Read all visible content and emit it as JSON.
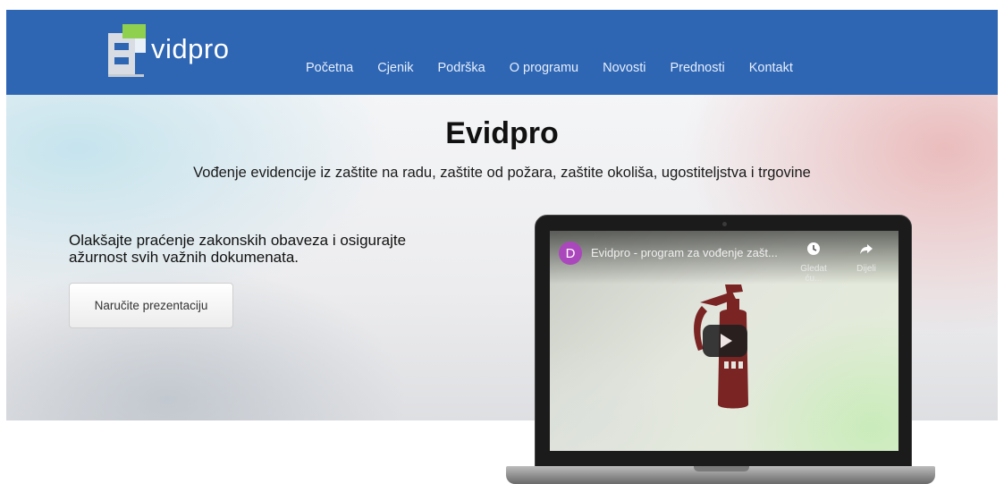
{
  "logo": {
    "text": "vidpro"
  },
  "nav": {
    "items": [
      "Početna",
      "Cjenik",
      "Podrška",
      "O programu",
      "Novosti",
      "Prednosti",
      "Kontakt"
    ]
  },
  "hero": {
    "title": "Evidpro",
    "subtitle": "Vođenje evidencije iz zaštite na radu, zaštite od požara, zaštite okoliša, ugostiteljstva i trgovine",
    "tagline_line1": "Olakšajte praćenje zakonskih obaveza i osigurajte",
    "tagline_line2": "ažurnost svih važnih dokumenata.",
    "button_label": "Naručite prezentaciju"
  },
  "video": {
    "avatar_letter": "D",
    "title": "Evidpro - program za vođenje zašt...",
    "watch_later": "Gledat ću...",
    "share": "Dijeli"
  },
  "colors": {
    "navbar": "#2e66b4",
    "logo_green": "#8fd14f",
    "extinguisher": "#7a2424",
    "avatar": "#ab47bc"
  },
  "icons": [
    "logo-e-icon",
    "clock-icon",
    "share-icon",
    "play-icon",
    "fire-extinguisher-icon"
  ]
}
